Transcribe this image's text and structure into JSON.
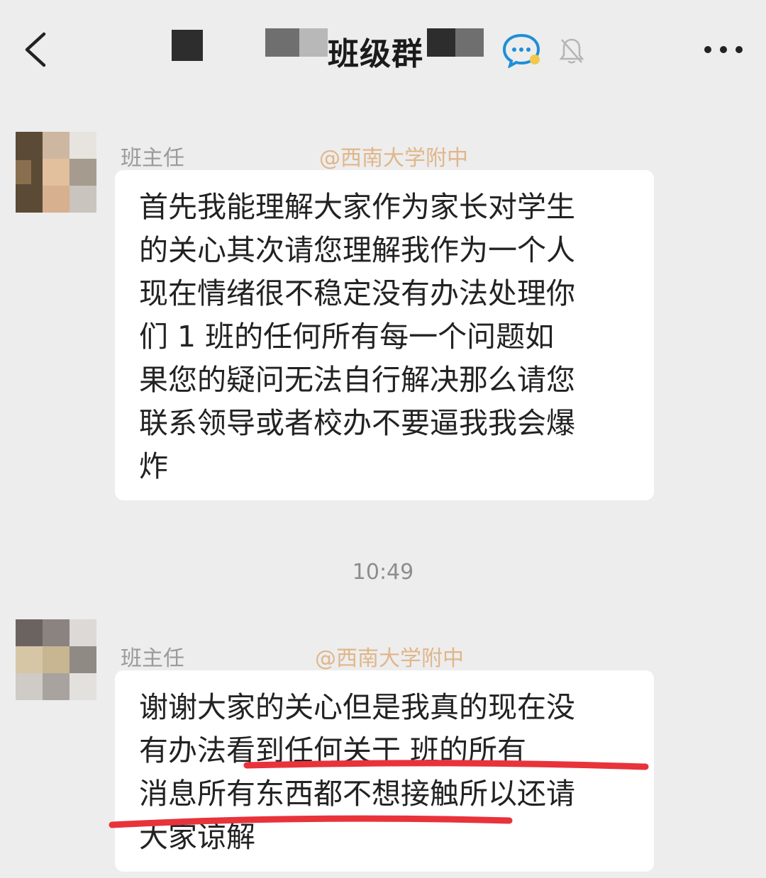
{
  "header": {
    "title": "班级群",
    "back_icon": "chevron-left-icon",
    "chat_icon": "chat-bubble-icon",
    "mute_icon": "bell-muted-icon",
    "more_icon": "more-dots-icon"
  },
  "messages": [
    {
      "sender": "班主任",
      "school": "@西南大学附中",
      "lines": [
        "首先我能理解大家作为家长对学生",
        "的关心其次请您理解我作为一个人",
        "现在情绪很不稳定没有办法处理你",
        "们 1 班的任何所有每一个问题如",
        "果您的疑问无法自行解决那么请您",
        "联系领导或者校办不要逼我我会爆",
        "炸"
      ]
    },
    {
      "sender": "班主任",
      "school": "@西南大学附中",
      "lines": [
        "谢谢大家的关心但是我真的现在没",
        "有办法看到任何关于 班的所有",
        "消息所有东西都不想接触所以还请",
        "大家谅解"
      ]
    }
  ],
  "timestamp": "10:49",
  "colors": {
    "background": "#ededed",
    "bubble": "#ffffff",
    "school_tag": "#e0b68a",
    "annotation_red": "#e8333a"
  }
}
